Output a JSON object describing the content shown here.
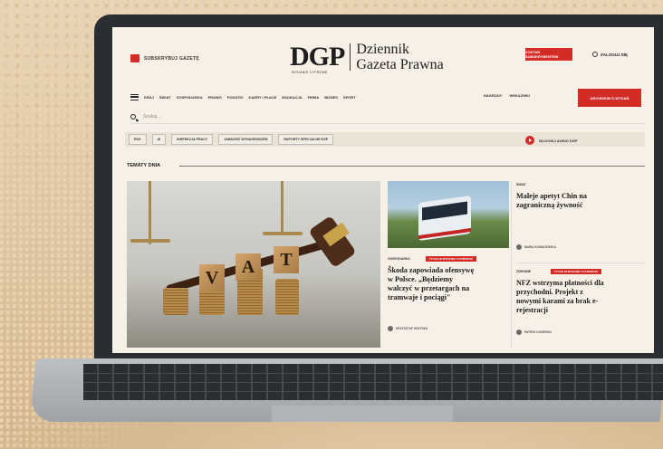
{
  "site": {
    "gift_label": "SUBSKRYBUJ GAZETĘ",
    "logo_letters": "DGP",
    "logo_sub": "WYDANIE CYFROWE",
    "logo_name_1": "Dziennik",
    "logo_name_2": "Gazeta Prawna",
    "subscribe_label": "ZOSTAŃ SUBSKRYBENTEM",
    "login_label": "ZALOGUJ SIĘ"
  },
  "nav": {
    "items": [
      "KRAJ",
      "ŚWIAT",
      "GOSPODARKA",
      "PRAWO",
      "PODATKI",
      "KADRY I PŁACE",
      "EDUKACJA",
      "FIRMA",
      "BIZNES",
      "SPORT"
    ],
    "right_items": [
      "NAGRODY",
      "WSKAŹNIKI"
    ],
    "archive_label": "ARCHIWUM E-WYDAŃ"
  },
  "search": {
    "placeholder": "Szukaj..."
  },
  "tags": [
    "ESG",
    "AI",
    "INSPEKCJA PRACY",
    "JAWNOŚĆ WYNAGRODZEŃ",
    "RAPORTY SPECJALNE DGP"
  ],
  "listen_label": "SŁUCHAJ AUDIO DGP",
  "section_title": "TEMATY DNIA",
  "hero": {
    "cube_letters": [
      "V",
      "A",
      "T"
    ]
  },
  "articles": [
    {
      "kicker": "GOSPODARKA",
      "badge": "TYLKO W WYDANIU CYFROWYM",
      "title_lines": [
        "Škoda zapowiada ofensywę",
        "w Polsce. „Będziemy",
        "walczyć w przetargach na",
        "tramwaje i pociągi\""
      ],
      "author": "KRZYSZTOF KRZYSKA"
    },
    {
      "kicker": "ŚWIAT",
      "title_lines": [
        "Maleje apetyt Chin na",
        "zagraniczną żywność"
      ],
      "author": "MARIA KOWALEWSKA"
    },
    {
      "kicker": "ZDROWIE",
      "badge": "TYLKO W WYDANIU CYFROWYM",
      "title_lines": [
        "NFZ wstrzyma płatności dla",
        "przychodni. Projekt z",
        "nowymi karami za brak e-",
        "rejestracji"
      ],
      "author": "PATRYK KOZERSKI"
    }
  ],
  "colors": {
    "accent": "#d32c26",
    "page_bg": "#f6f0e6",
    "laptop": "#2a2d31"
  }
}
